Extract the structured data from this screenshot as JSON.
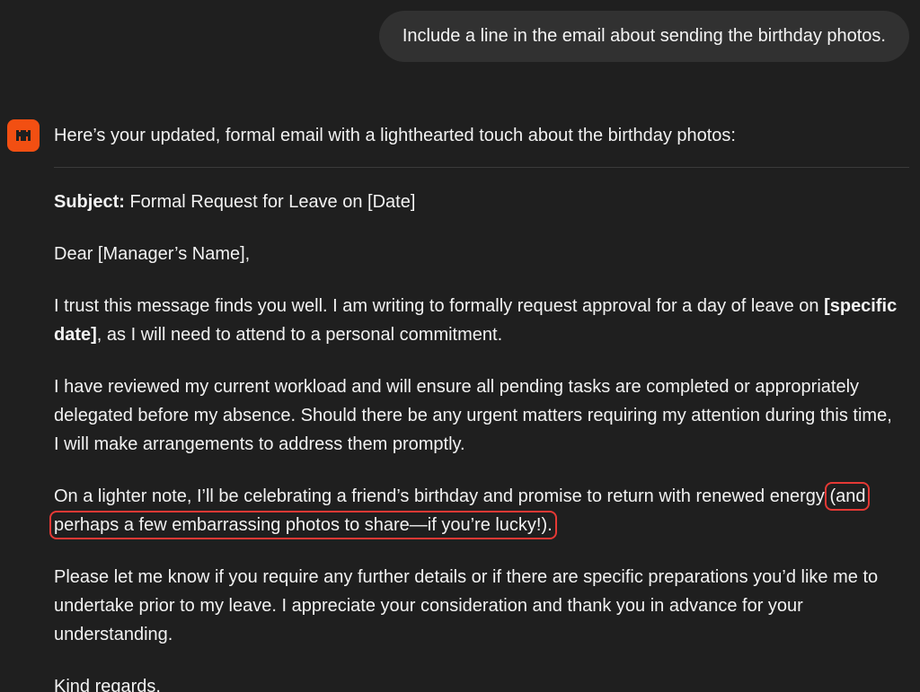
{
  "user_message": "Include a line in the email about sending the birthday photos.",
  "assistant": {
    "avatar_icon": "assistant-logo-icon",
    "avatar_color": "#f24f12",
    "intro": "Here’s your updated, formal email with a lighthearted touch about the birthday photos:",
    "email": {
      "subject_label": "Subject:",
      "subject": " Formal Request for Leave on [Date]",
      "greeting": "Dear [Manager’s Name],",
      "para1_a": "I trust this message finds you well. I am writing to formally request approval for a day of leave on ",
      "para1_bold": "[specific date]",
      "para1_b": ", as I will need to attend to a personal commitment.",
      "para2": "I have reviewed my current workload and will ensure all pending tasks are completed or appropriately delegated before my absence. Should there be any urgent matters requiring my attention during this time, I will make arrangements to address them promptly.",
      "para3_a": "On a lighter note, I’ll be celebrating a friend’s birthday and promise to return with renewed energy ",
      "para3_highlight": "(and perhaps a few embarrassing photos to share—if you’re lucky!).",
      "para4": "Please let me know if you require any further details or if there are specific preparations you’d like me to undertake prior to my leave. I appreciate your consideration and thank you in advance for your understanding.",
      "closing": "Kind regards,"
    }
  },
  "highlight_color": "#e53935"
}
